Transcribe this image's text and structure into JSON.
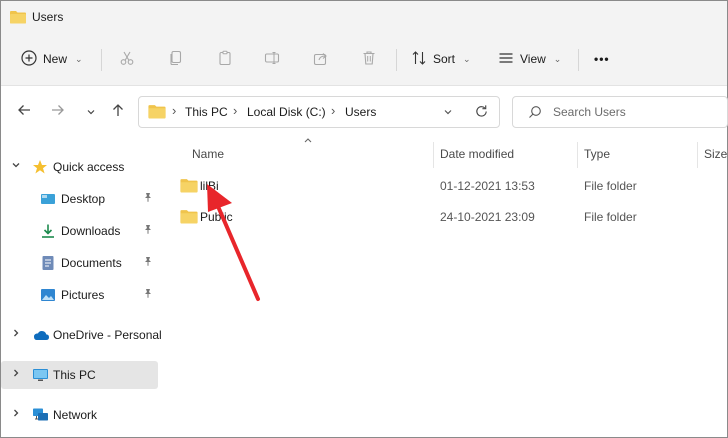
{
  "window": {
    "title": "Users"
  },
  "toolbar": {
    "new_label": "New",
    "sort_label": "Sort",
    "view_label": "View",
    "more_label": "•••"
  },
  "address": {
    "crumbs": [
      "This PC",
      "Local Disk (C:)",
      "Users"
    ],
    "search_placeholder": "Search Users"
  },
  "sidebar": {
    "items": [
      {
        "label": "Quick access",
        "icon": "star-icon"
      },
      {
        "label": "Desktop",
        "icon": "desktop-icon"
      },
      {
        "label": "Downloads",
        "icon": "download-icon"
      },
      {
        "label": "Documents",
        "icon": "document-icon"
      },
      {
        "label": "Pictures",
        "icon": "picture-icon"
      },
      {
        "label": "OneDrive - Personal",
        "icon": "cloud-icon"
      },
      {
        "label": "This PC",
        "icon": "computer-icon"
      },
      {
        "label": "Network",
        "icon": "network-icon"
      }
    ]
  },
  "columns": [
    "Name",
    "Date modified",
    "Type",
    "Size"
  ],
  "files": [
    {
      "name": "lilBi",
      "date": "01-12-2021 13:53",
      "type": "File folder"
    },
    {
      "name": "Public",
      "date": "24-10-2021 23:09",
      "type": "File folder"
    }
  ],
  "colors": {
    "folder": "#f0c44c",
    "accent": "#0067c0",
    "annotation": "#e8262b",
    "selection": "#e5e5e5"
  }
}
